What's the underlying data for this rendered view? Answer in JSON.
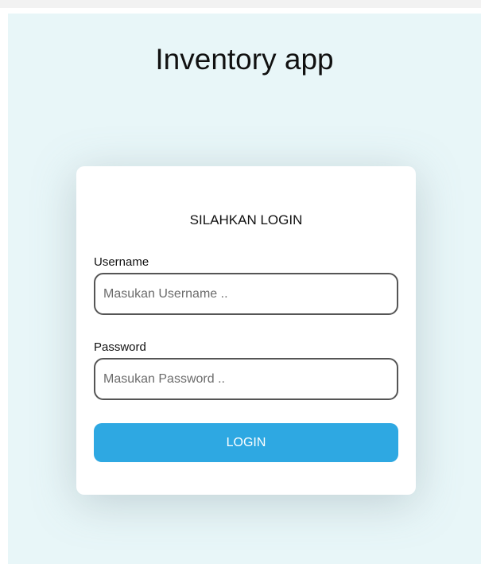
{
  "app": {
    "title": "Inventory app"
  },
  "login_card": {
    "heading": "SILAHKAN LOGIN",
    "username": {
      "label": "Username",
      "placeholder": "Masukan Username ..",
      "value": ""
    },
    "password": {
      "label": "Password",
      "placeholder": "Masukan Password ..",
      "value": ""
    },
    "submit_label": "LOGIN"
  },
  "colors": {
    "page_background": "#e8f6f8",
    "card_background": "#ffffff",
    "button_accent": "#2ea8e2",
    "input_border": "#555555"
  }
}
